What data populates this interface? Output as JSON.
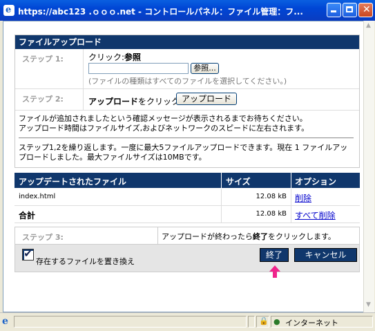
{
  "window": {
    "title": "https://abc123 .ｏｏｏ.net - コントロールパネル：ファイル管理：フ..."
  },
  "upload": {
    "header": "ファイルアップロード",
    "step1_label": "ステップ 1:",
    "click_text": "クリック:",
    "browse_word": "参照",
    "browse_button": "参照...",
    "file_hint": "(ファイルの種類はすべてのファイルを選択してください。)",
    "step2_label": "ステップ 2:",
    "step2_text_bold": "アップロード",
    "step2_text": "をクリック。",
    "upload_button": "アップロード",
    "info1": "ファイルが追加されましたという確認メッセージが表示されるまでお待ちください。",
    "info2": "アップロード時間はファイルサイズ,およびネットワークのスピードに左右されます。",
    "repeat_text": "ステップ1,2を繰り返します。一度に最大5ファイルアップロードできます。現在 1 ファイルアップロードしました。最大ファイルサイズは10MBです。"
  },
  "files_table": {
    "headers": [
      "アップデートされたファイル",
      "サイズ",
      "オプション"
    ],
    "rows": [
      {
        "name": "index.html",
        "size": "12.08 kB",
        "option": "削除"
      }
    ],
    "total_label": "合計",
    "total_size": "12.08 kB",
    "total_option": "すべて削除"
  },
  "step3": {
    "label": "ステップ 3:",
    "text_pre": "アップロードが終わったら",
    "text_bold": "終了",
    "text_post": "をクリックします。",
    "overwrite_label": "存在するファイルを置き換え",
    "overwrite_checked": true,
    "finish_button": "終了",
    "cancel_button": "キャンセル"
  },
  "statusbar": {
    "zone": "インターネット"
  }
}
